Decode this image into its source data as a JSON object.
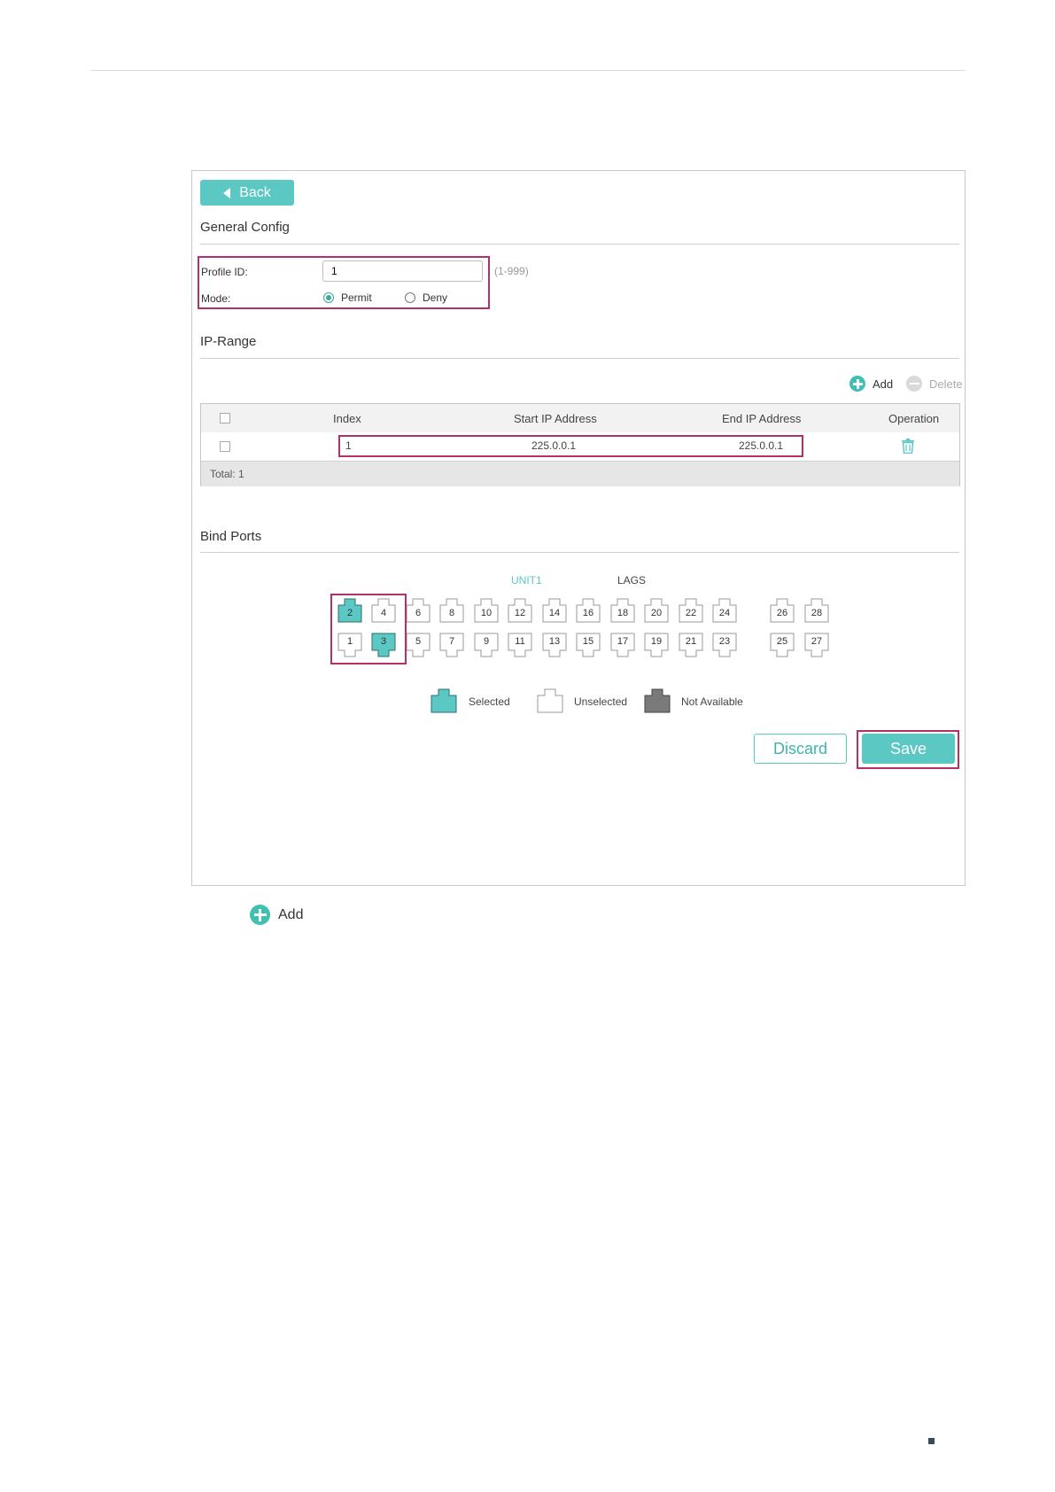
{
  "back_label": "Back",
  "general": {
    "title": "General Config",
    "profile_label": "Profile ID:",
    "profile_value": "1",
    "profile_hint": "(1-999)",
    "mode_label": "Mode:",
    "mode_options": [
      "Permit",
      "Deny"
    ],
    "mode_selected": "Permit"
  },
  "iprange": {
    "title": "IP-Range",
    "add_label": "Add",
    "delete_label": "Delete",
    "columns": [
      "Index",
      "Start IP Address",
      "End IP Address",
      "Operation"
    ],
    "rows": [
      {
        "index": "1",
        "start": "225.0.0.1",
        "end": "225.0.0.1"
      }
    ],
    "total": "Total: 1"
  },
  "bind": {
    "title": "Bind Ports",
    "tab_unit": "UNIT1",
    "tab_lags": "LAGS",
    "top_ports": [
      "2",
      "4",
      "6",
      "8",
      "10",
      "12",
      "14",
      "16",
      "18",
      "20",
      "22",
      "24",
      "26",
      "28"
    ],
    "bottom_ports": [
      "1",
      "3",
      "5",
      "7",
      "9",
      "11",
      "13",
      "15",
      "17",
      "19",
      "21",
      "23",
      "25",
      "27"
    ],
    "selected_ports": [
      "2",
      "3"
    ],
    "legend": [
      "Selected",
      "Unselected",
      "Not Available"
    ],
    "colors": {
      "selected": "#5bc8c4",
      "unselected": "#ffffff",
      "not_available": "#7a7a7a",
      "accent": "#5bc8c4",
      "highlight": "#b0316b"
    }
  },
  "actions": {
    "discard": "Discard",
    "save": "Save"
  },
  "below_add_label": "Add"
}
